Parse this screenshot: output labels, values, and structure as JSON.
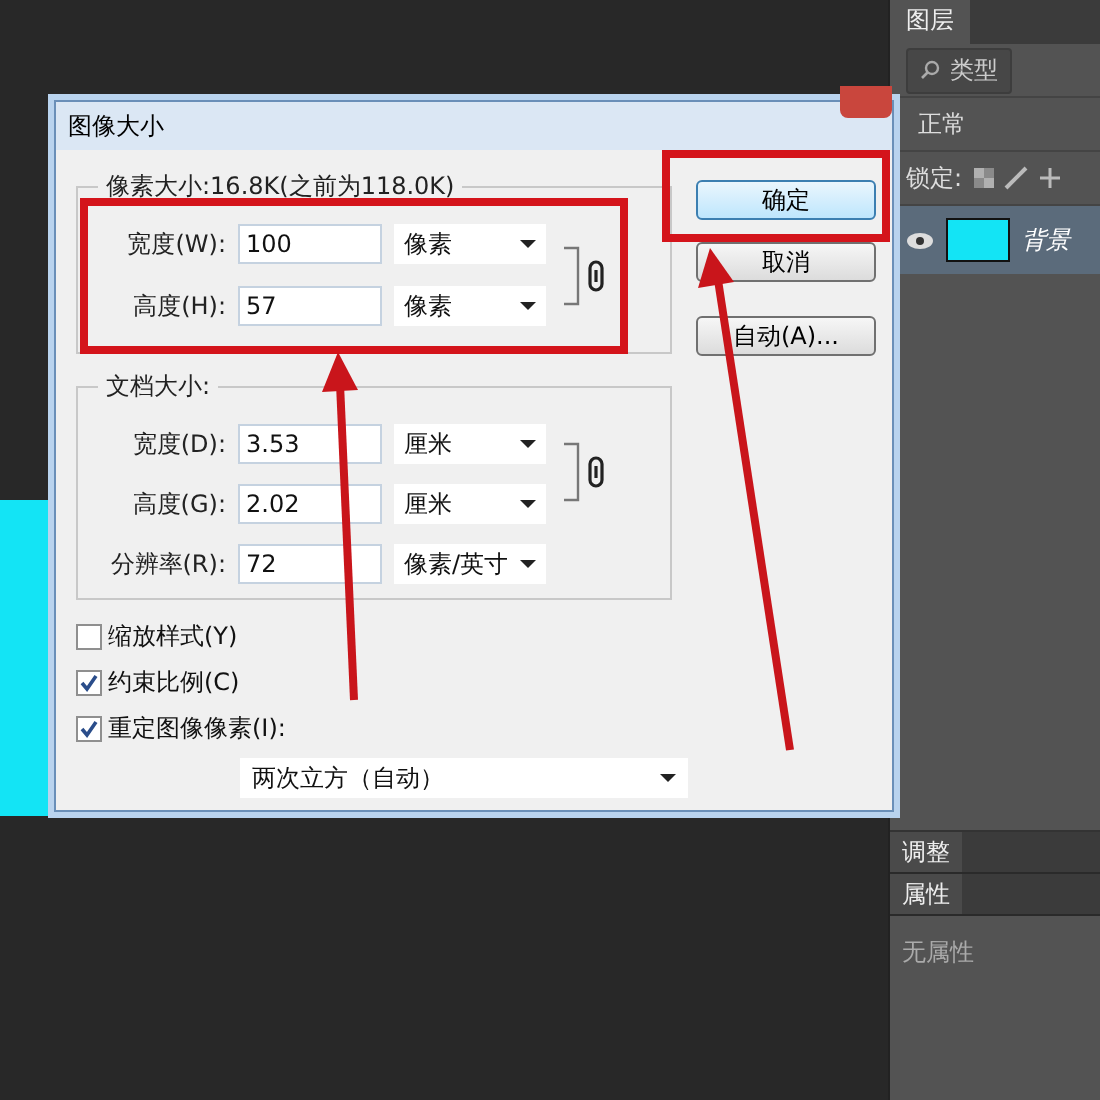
{
  "panel": {
    "tab": "图层",
    "filter": "类型",
    "blend_mode": "正常",
    "lock_label": "锁定:",
    "layer": {
      "name": "背景",
      "visible": true
    },
    "tabs2": [
      "调整",
      "属性"
    ],
    "properties_empty": "无属性"
  },
  "dialog": {
    "title": "图像大小",
    "pixel_dimensions": {
      "legend": "像素大小:16.8K(之前为118.0K)",
      "rows": [
        {
          "label": "宽度(W):",
          "value": "100",
          "unit": "像素"
        },
        {
          "label": "高度(H):",
          "value": "57",
          "unit": "像素"
        }
      ],
      "linked": true
    },
    "document_size": {
      "legend": "文档大小:",
      "rows": [
        {
          "label": "宽度(D):",
          "value": "3.53",
          "unit": "厘米"
        },
        {
          "label": "高度(G):",
          "value": "2.02",
          "unit": "厘米"
        },
        {
          "label": "分辨率(R):",
          "value": "72",
          "unit": "像素/英寸"
        }
      ],
      "linked": true
    },
    "checkboxes": [
      {
        "label": "缩放样式(Y)",
        "checked": false
      },
      {
        "label": "约束比例(C)",
        "checked": true
      },
      {
        "label": "重定图像像素(I):",
        "checked": true
      }
    ],
    "resample": "两次立方（自动）",
    "buttons": [
      {
        "label": "确定",
        "selected": true
      },
      {
        "label": "取消",
        "selected": false
      },
      {
        "label": "自动(A)...",
        "selected": false
      }
    ]
  }
}
